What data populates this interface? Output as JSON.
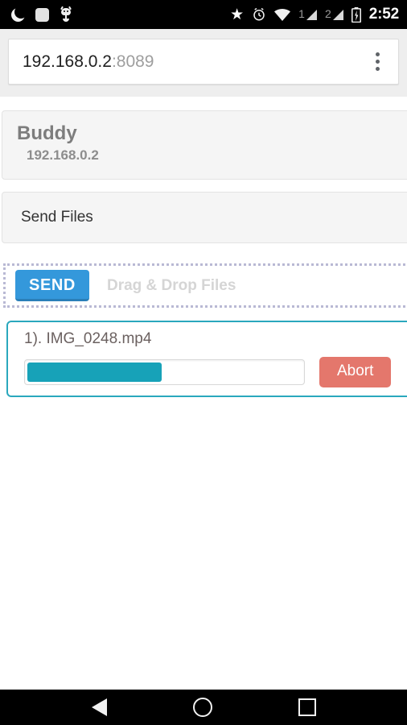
{
  "status_bar": {
    "icons_left": [
      "moon-icon",
      "rounded-square-icon",
      "bug-icon"
    ],
    "icons_right": [
      "star-icon",
      "alarm-icon",
      "wifi-icon",
      "signal-icon",
      "signal-icon",
      "battery-charging-icon"
    ],
    "sim1_label": "1",
    "sim2_label": "2",
    "clock": "2:52"
  },
  "browser": {
    "url_host": "192.168.0.2",
    "url_port": ":8089",
    "overflow_menu_name": "more-options"
  },
  "buddy_panel": {
    "title": "Buddy",
    "ip": "192.168.0.2"
  },
  "send_files_panel": {
    "label": "Send Files"
  },
  "dropzone": {
    "send_label": "SEND",
    "hint": "Drag & Drop Files"
  },
  "transfers": [
    {
      "index_label": "1).",
      "file_name": "IMG_0248.mp4",
      "display_name": "1). IMG_0248.mp4",
      "progress_percent": 49,
      "progress_width": "49%",
      "abort_label": "Abort"
    }
  ],
  "colors": {
    "send_blue": "#3498db",
    "abort_red": "#e4776c",
    "progress_teal": "#17a2b8",
    "card_border_teal": "#2aa8bd",
    "panel_gray": "#f5f5f5"
  },
  "nav_bar": {
    "back": "back-icon",
    "home": "home-icon",
    "recents": "recents-icon"
  }
}
